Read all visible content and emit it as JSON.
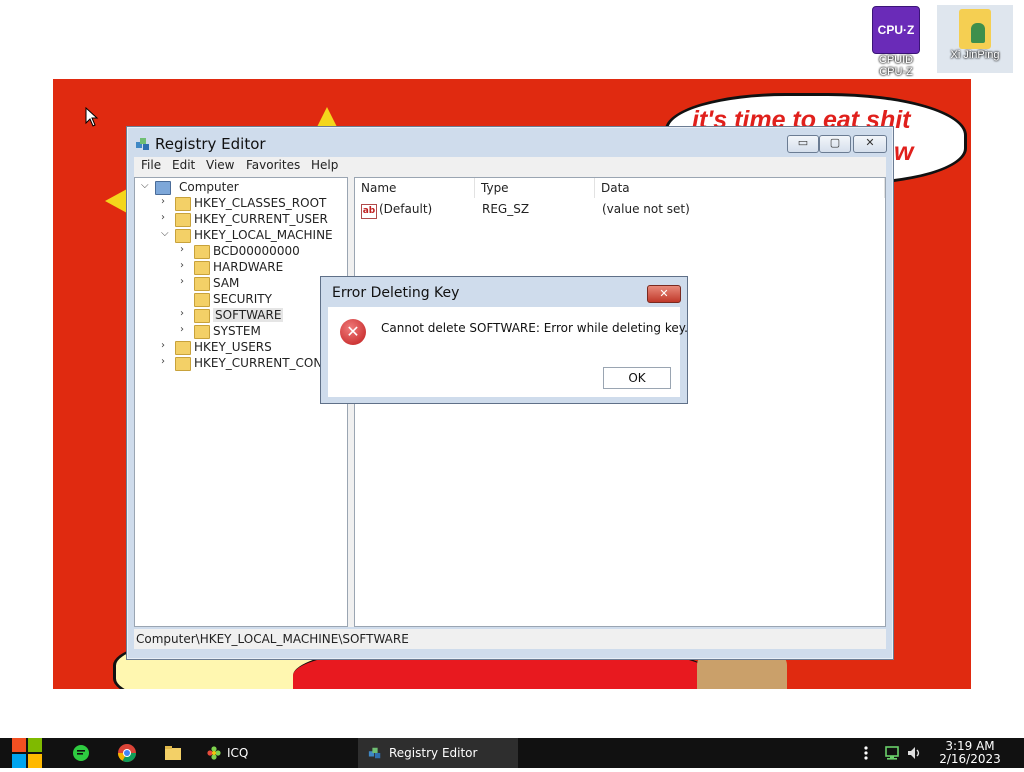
{
  "desktop": {
    "wallpaper": {
      "speech_line1": "it's time to eat shit",
      "speech_line2": "w"
    },
    "icons": [
      {
        "glyph": "CPU·Z",
        "line1": "CPUID",
        "line2": "CPU-Z"
      },
      {
        "label": "Xi JinPing"
      }
    ]
  },
  "registry_editor": {
    "title": "Registry Editor",
    "caption_buttons": {
      "minimize": "▭",
      "maximize": "▢",
      "close": "✕"
    },
    "menu": [
      "File",
      "Edit",
      "View",
      "Favorites",
      "Help"
    ],
    "tree": [
      {
        "arrow": "⌵",
        "label": "Computer"
      },
      {
        "arrow": "›",
        "label": "HKEY_CLASSES_ROOT"
      },
      {
        "arrow": "›",
        "label": "HKEY_CURRENT_USER"
      },
      {
        "arrow": "⌵",
        "label": "HKEY_LOCAL_MACHINE"
      },
      {
        "arrow": "›",
        "label": "BCD00000000"
      },
      {
        "arrow": "›",
        "label": "HARDWARE"
      },
      {
        "arrow": "›",
        "label": "SAM"
      },
      {
        "arrow": "",
        "label": "SECURITY"
      },
      {
        "arrow": "›",
        "label": "SOFTWARE"
      },
      {
        "arrow": "›",
        "label": "SYSTEM"
      },
      {
        "arrow": "›",
        "label": "HKEY_USERS"
      },
      {
        "arrow": "›",
        "label": "HKEY_CURRENT_CON"
      }
    ],
    "columns": [
      "Name",
      "Type",
      "Data"
    ],
    "rows": [
      {
        "icon": "ab",
        "name": "(Default)",
        "type": "REG_SZ",
        "data": "(value not set)"
      }
    ],
    "status_path": "Computer\\HKEY_LOCAL_MACHINE\\SOFTWARE"
  },
  "error_dialog": {
    "title": "Error Deleting Key",
    "close_glyph": "✕",
    "icon": "✕",
    "message": "Cannot delete SOFTWARE:  Error while deleting key.",
    "ok_label": "OK"
  },
  "taskbar": {
    "tasks": [
      {
        "label": "ICQ"
      },
      {
        "label": "Registry Editor"
      }
    ],
    "time": "3:19 AM",
    "date": "2/16/2023"
  }
}
